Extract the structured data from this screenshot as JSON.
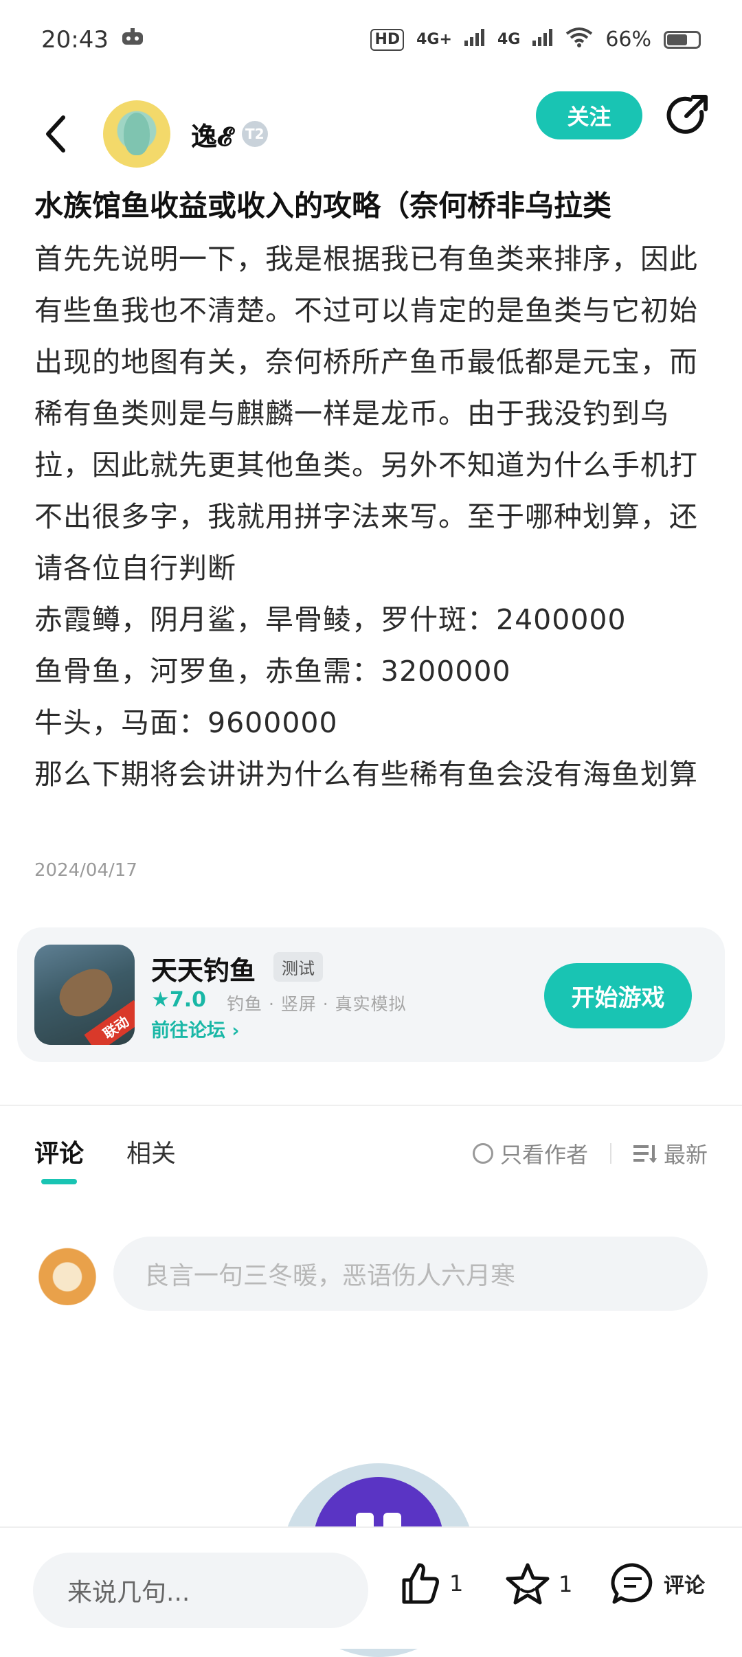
{
  "status_bar": {
    "time": "20:43",
    "network": [
      "HD",
      "4G+",
      "4G"
    ],
    "battery": "66%"
  },
  "header": {
    "username": "逸𝓔",
    "level": "T2",
    "follow_label": "关注",
    "icons": [
      "back-arrow-icon",
      "share-icon"
    ]
  },
  "post": {
    "title": "水族馆鱼收益或收入的攻略（奈何桥非乌拉类",
    "paragraphs": [
      "首先先说明一下，我是根据我已有鱼类来排序，因此有些鱼我也不清楚。不过可以肯定的是鱼类与它初始出现的地图有关，奈何桥所产鱼币最低都是元宝，而稀有鱼类则是与麒麟一样是龙币。由于我没钓到乌拉，因此就先更其他鱼类。另外不知道为什么手机打不出很多字，我就用拼字法来写。至于哪种划算，还请各位自行判断",
      "赤霞鳟，阴月鲨，旱骨鲮，罗什斑：2400000",
      "鱼骨鱼，河罗鱼，赤鱼需：3200000",
      "牛头，马面：9600000",
      "那么下期将会讲讲为什么有些稀有鱼会没有海鱼划算"
    ],
    "date": "2024/04/17"
  },
  "game_card": {
    "name": "天天钓鱼",
    "tag": "测试",
    "icon_badge": "联动",
    "rating": "7.0",
    "categories": "钓鱼 · 竖屏 · 真实模拟",
    "forum_link": "前往论坛",
    "play_label": "开始游戏"
  },
  "comments": {
    "tabs": [
      "评论",
      "相关"
    ],
    "author_only": "只看作者",
    "sort": "最新",
    "input_placeholder": "良言一句三冬暖，恶语伤人六月寒"
  },
  "bottom_bar": {
    "reply_placeholder": "来说几句...",
    "likes": "1",
    "favorites": "1",
    "comment_label": "评论"
  },
  "colors": {
    "accent": "#19c4b3"
  }
}
